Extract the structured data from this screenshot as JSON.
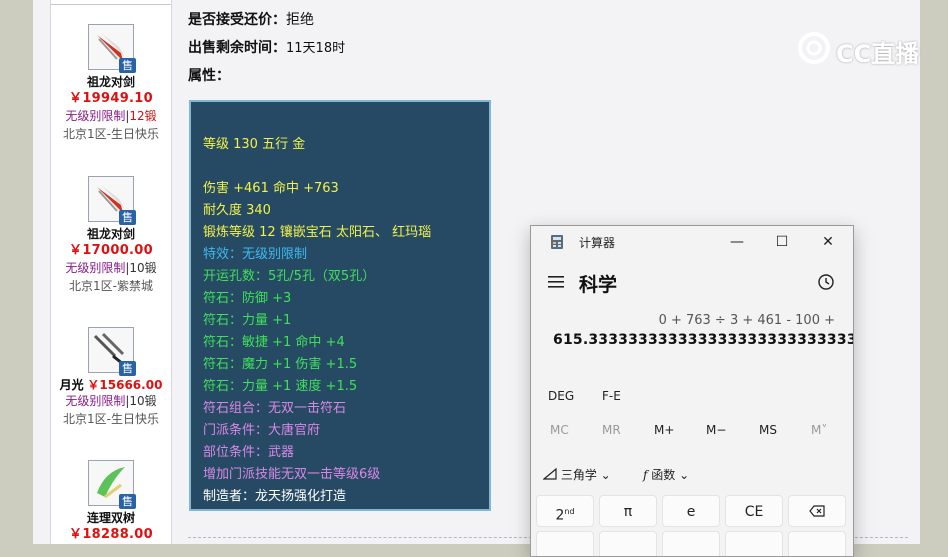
{
  "listing": [
    {
      "name": "祖龙对剑",
      "price": "￥19949.10",
      "limit": "无级别限制",
      "level": "12锻",
      "server": "北京1区-生日快乐",
      "sale": "售"
    },
    {
      "name": "祖龙对剑",
      "price": "￥17000.00",
      "limit": "无级别限制",
      "level": "10锻",
      "server": "北京1区-紫禁城",
      "sale": "售"
    },
    {
      "name": "月光",
      "price": "￥15666.00",
      "limit": "无级别限制",
      "level": "10锻",
      "server": "北京1区-生日快乐",
      "sale": "售"
    },
    {
      "name": "连理双树",
      "price": "￥18288.00",
      "sale": "售"
    }
  ],
  "info": {
    "bargain_label": "是否接受还价：",
    "bargain_value": "拒绝",
    "time_label": "出售剩余时间：",
    "time_value": "11天18时",
    "attr_label": "属性："
  },
  "stats": [
    {
      "text": "等级 130 五行 金",
      "color": "y"
    },
    {
      "text": "伤害 +461 命中 +763",
      "color": "y"
    },
    {
      "text": "耐久度 340",
      "color": "y"
    },
    {
      "text": "锻炼等级 12 镶嵌宝石 太阳石、 红玛瑙",
      "color": "y"
    },
    {
      "text": "特效：无级别限制",
      "color": "c"
    },
    {
      "text": "开运孔数：5孔/5孔（双5孔）",
      "color": "g"
    },
    {
      "text": "符石：防御 +3",
      "color": "g"
    },
    {
      "text": "符石：力量 +1",
      "color": "g"
    },
    {
      "text": "符石：敏捷 +1 命中 +4",
      "color": "g"
    },
    {
      "text": "符石：魔力 +1 伤害 +1.5",
      "color": "g"
    },
    {
      "text": "符石：力量 +1 速度 +1.5",
      "color": "g"
    },
    {
      "text": "符石组合：无双一击符石",
      "color": "p"
    },
    {
      "text": "门派条件：大唐官府",
      "color": "p"
    },
    {
      "text": "部位条件：武器",
      "color": "p"
    },
    {
      "text": "增加门派技能无双一击等级6级",
      "color": "p"
    },
    {
      "text": "制造者：龙天扬强化打造",
      "color": "w"
    }
  ],
  "watermark": "CC直播",
  "calculator": {
    "title": "计算器",
    "mode": "科学",
    "expression": "0 + 763 ÷ 3 + 461 - 100 +",
    "result": "615.3333333333333333333333333333",
    "deg": "DEG",
    "fe": "F-E",
    "memory": [
      "MC",
      "MR",
      "M+",
      "M−",
      "MS",
      "M˅"
    ],
    "trig": "三角学",
    "func": "函数",
    "keys": [
      "2nd",
      "π",
      "e",
      "CE",
      "⌫"
    ],
    "minimize": "—",
    "maximize": "☐",
    "close": "✕"
  }
}
